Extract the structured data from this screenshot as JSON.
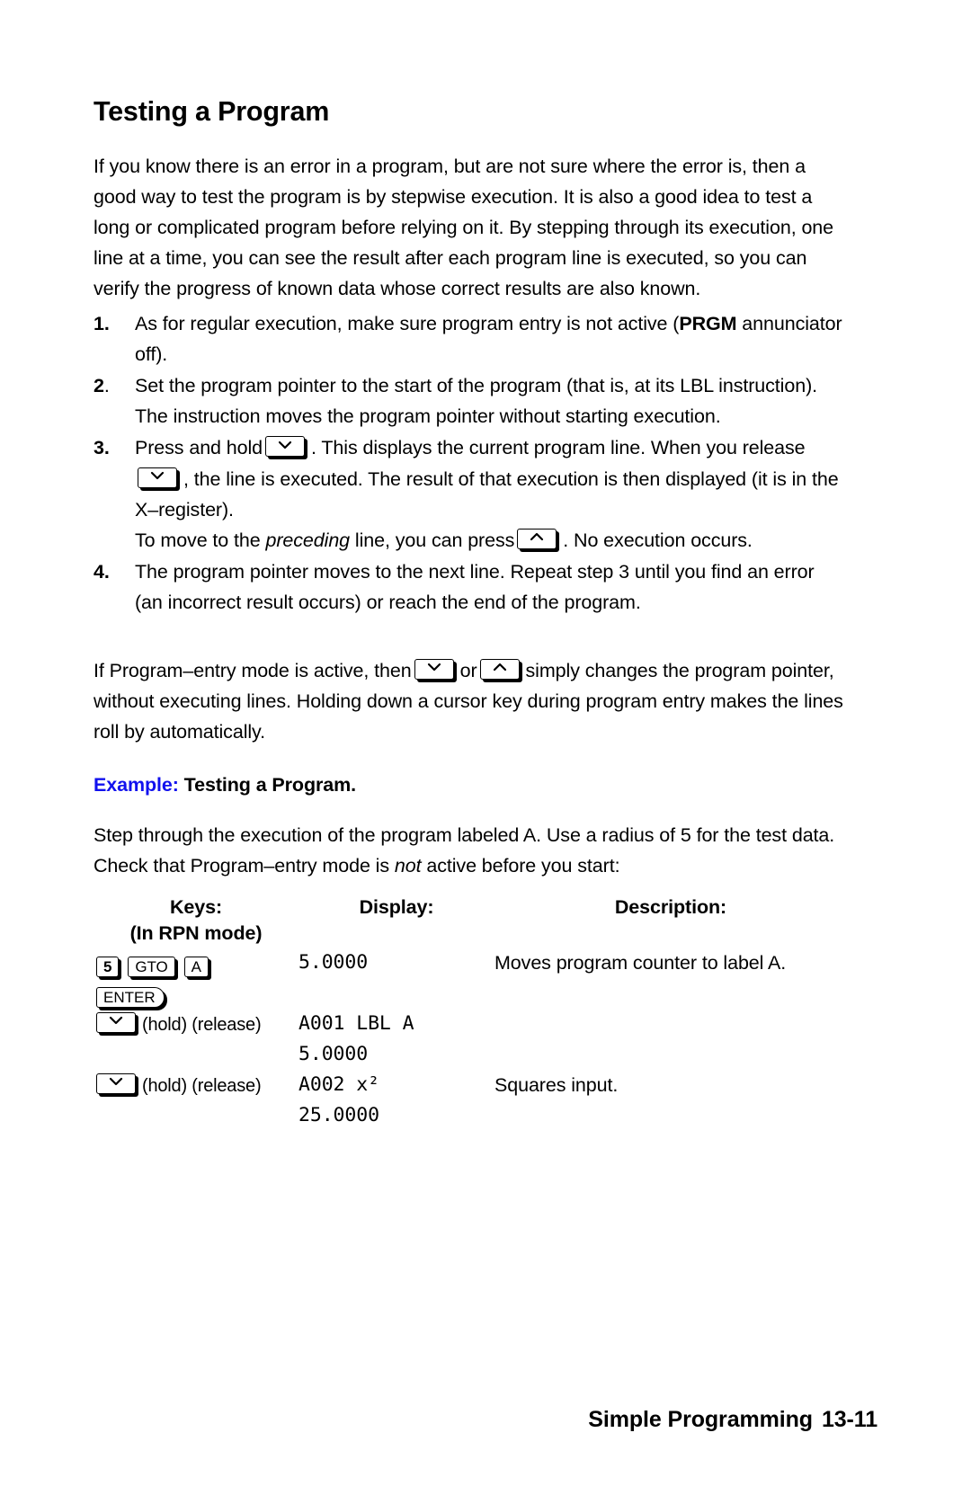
{
  "document": {
    "title": "Testing a Program",
    "intro": "If you know there is an error in a program, but are not sure where the error is, then a good way to test the program is by stepwise execution. It is also a good idea to test a long or complicated program before relying on it. By stepping through its execution, one line at a time, you can see the result after each program line is executed, so you can verify the progress of known data whose correct results are also known."
  },
  "steps": [
    {
      "number": "1.",
      "text_before": "As for regular execution, make sure program entry is not active (",
      "emphasis": "PRGM",
      "text_after": " annunciator off)."
    },
    {
      "number": "2",
      "number_suffix": ".",
      "text": "Set the program pointer to the start of the program (that is, at its LBL instruction). The instruction moves the program pointer without starting execution."
    },
    {
      "number": "3.",
      "part1": "Press and hold",
      "key1": "down-arrow-key",
      "part2": ". This displays the current program line. When you release",
      "key2": "down-arrow-key",
      "part3": ", the line is executed. The result of that execution is then displayed (it is in the X–register).",
      "sub_part1": "To move to the",
      "sub_emphasis": "preceding",
      "sub_part2": "line, you can press",
      "sub_key": "up-arrow-key",
      "sub_part3": ". No execution occurs."
    },
    {
      "number": "4.",
      "text": "The program pointer moves to the next line. Repeat step 3 until you find an error (an incorrect result occurs) or reach the end of the program."
    }
  ],
  "note": {
    "part1": "If Program–entry mode is active, then",
    "key1": "down-arrow-key",
    "conjunction": "or",
    "key2": "up-arrow-key",
    "part2": "simply changes the program pointer, without executing lines. Holding down a cursor key during program entry makes the lines roll by automatically."
  },
  "example": {
    "label": "Example:",
    "label_color": "#1111ee",
    "title": "Testing a Program.",
    "intro_part1": "Step through the execution of the program labeled A. Use a radius of 5 for the test data. Check that Program–entry mode is",
    "intro_emphasis": "not",
    "intro_part2": "active before you start:",
    "columns": {
      "keys": "Keys:",
      "keys_sub": "(In RPN mode)",
      "display": "Display:",
      "description": "Description:"
    },
    "rows": [
      {
        "keys": [
          {
            "type": "key",
            "label": "5",
            "bold": true
          },
          {
            "type": "key",
            "label": "GTO",
            "bold": false
          },
          {
            "type": "key",
            "label": "A",
            "bold": false
          }
        ],
        "display": [
          "5.0000"
        ],
        "description": "Moves program counter to label A."
      },
      {
        "keys": [
          {
            "type": "key",
            "label": "ENTER",
            "bold": false,
            "style": "enter"
          }
        ],
        "display": [],
        "description": ""
      },
      {
        "keys": [
          {
            "type": "arrow",
            "label": "down-arrow-key"
          },
          {
            "type": "text",
            "label": "(hold) (release)"
          }
        ],
        "display": [
          "A001 LBL A",
          "5.0000"
        ],
        "description": ""
      },
      {
        "keys": [
          {
            "type": "arrow",
            "label": "down-arrow-key"
          },
          {
            "type": "text",
            "label": "(hold) (release)"
          }
        ],
        "display": [
          "A002 x²",
          "25.0000"
        ],
        "description": "Squares input."
      }
    ]
  },
  "footer": {
    "section": "Simple Programming",
    "page": "13-11"
  }
}
